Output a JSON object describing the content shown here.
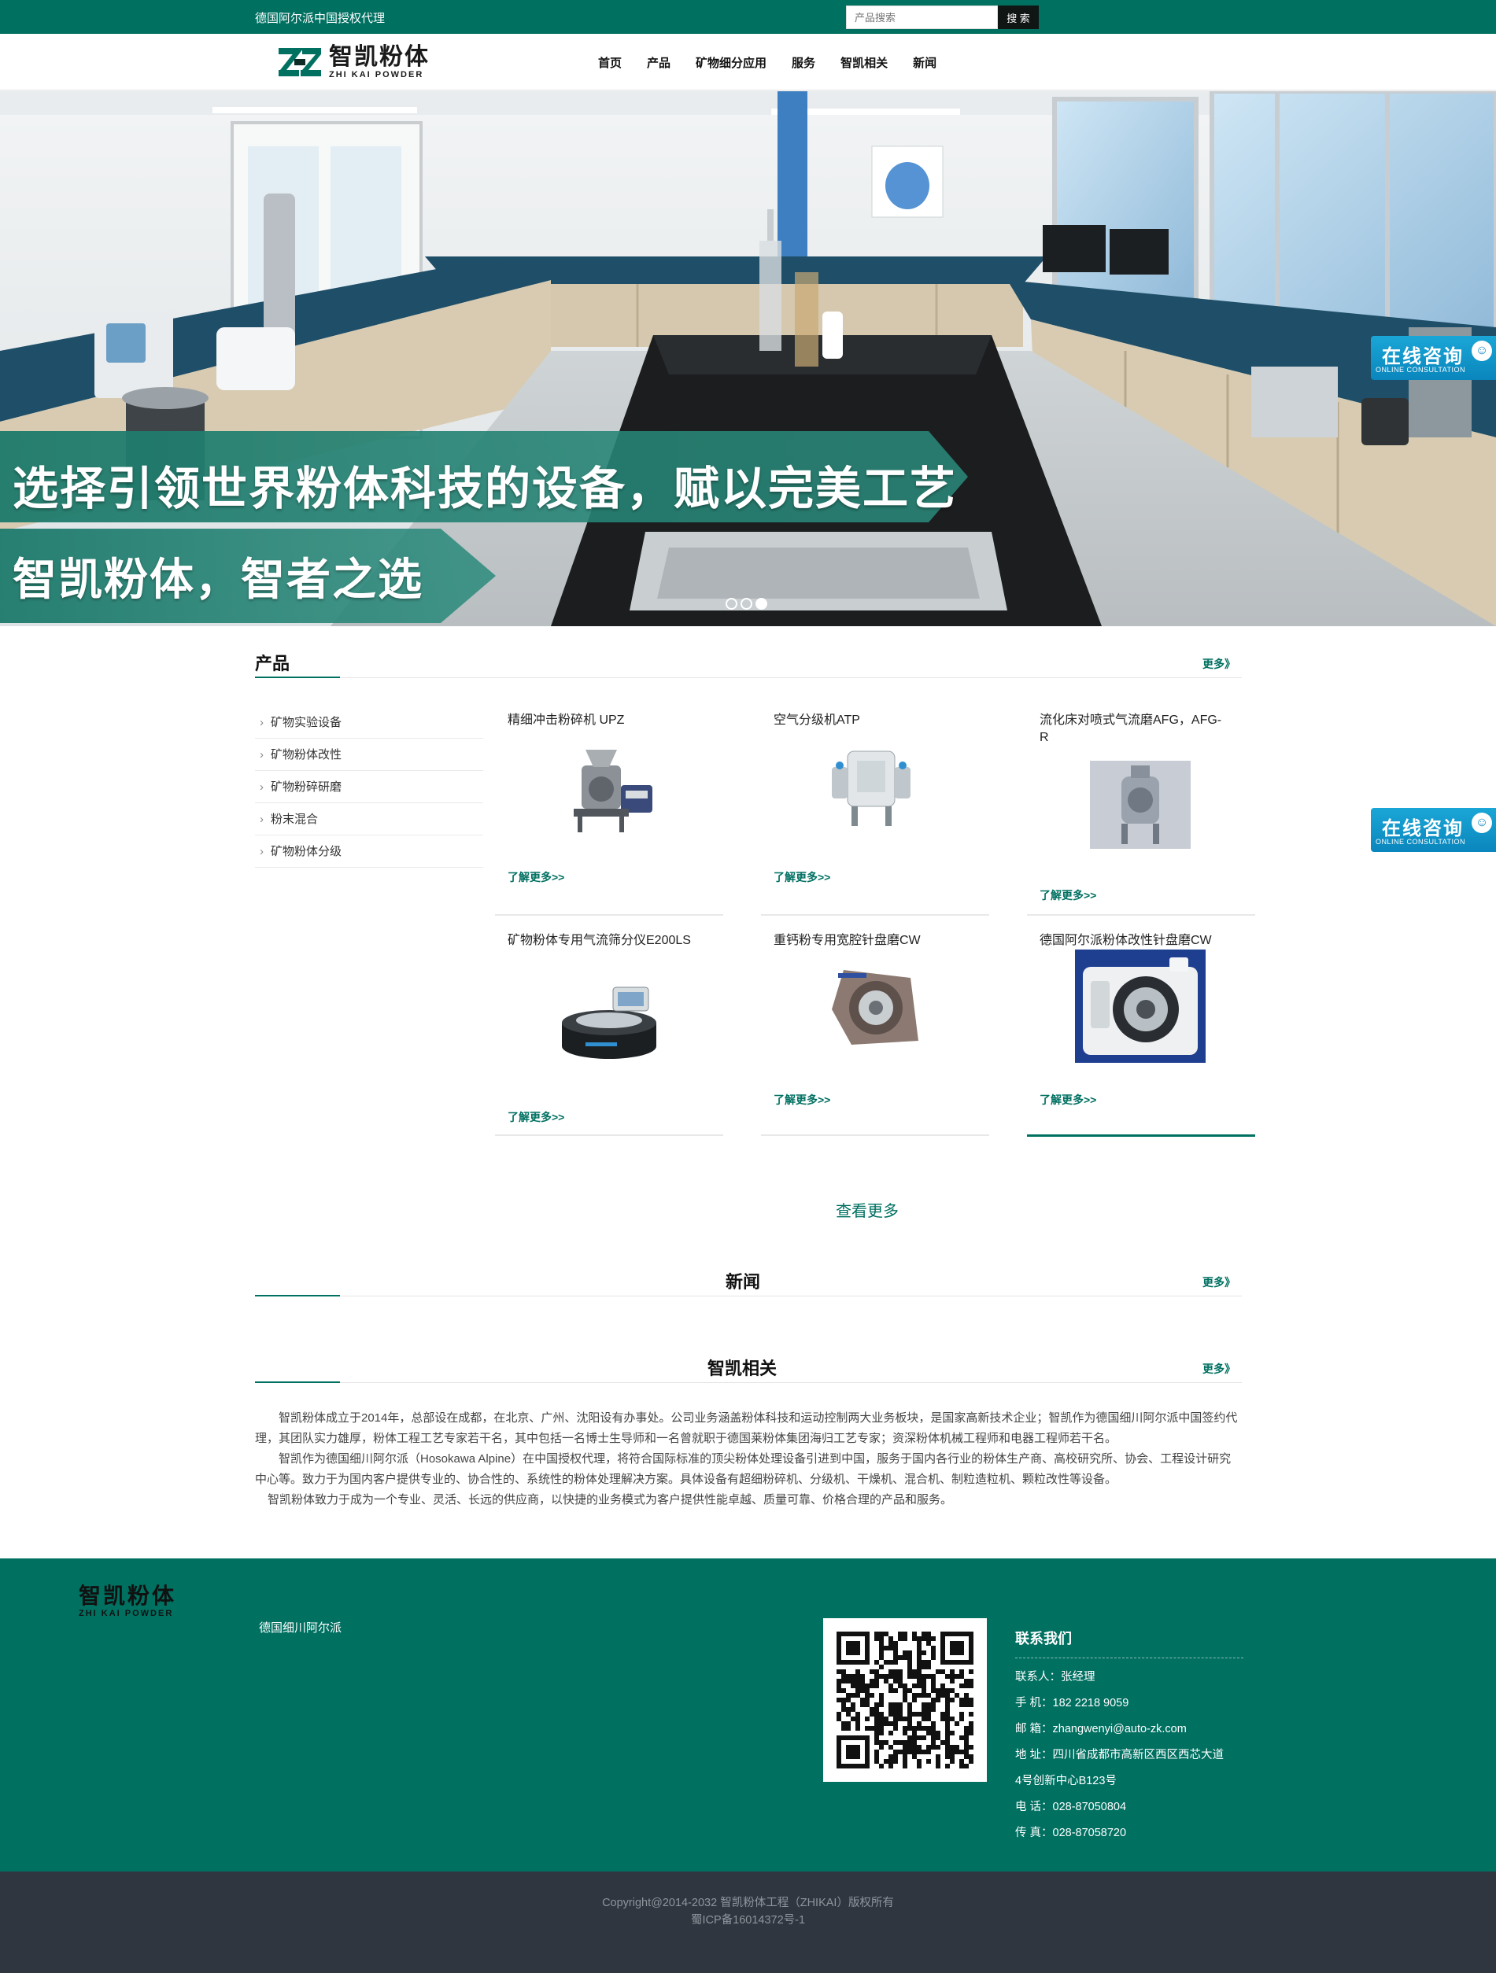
{
  "topbar": {
    "tagline": "德国阿尔派中国授权代理",
    "search_placeholder": "产品搜索",
    "search_button": "搜 索"
  },
  "logo": {
    "name_cn": "智凯粉体",
    "name_en": "ZHI KAI POWDER"
  },
  "nav": [
    "首页",
    "产品",
    "矿物细分应用",
    "服务",
    "智凯相关",
    "新闻"
  ],
  "banner": {
    "slogan_1": "选择引领世界粉体科技的设备，赋以完美工艺",
    "slogan_2": "智凯粉体，智者之选",
    "slide_count": 3,
    "active_slide": 3
  },
  "consult": {
    "label_cn": "在线咨询",
    "label_en": "ONLINE CONSULTATION"
  },
  "products": {
    "title": "产品",
    "more": "更多》",
    "categories": [
      "矿物实验设备",
      "矿物粉体改性",
      "矿物粉碎研磨",
      "粉末混合",
      "矿物粉体分级"
    ],
    "items": [
      {
        "name": "精细冲击粉碎机 UPZ",
        "link": "了解更多>>"
      },
      {
        "name": "空气分级机ATP",
        "link": "了解更多>>"
      },
      {
        "name": "流化床对喷式气流磨AFG，AFG-R",
        "link": "了解更多>>"
      },
      {
        "name": "矿物粉体专用气流筛分仪E200LS",
        "link": "了解更多>>"
      },
      {
        "name": "重钙粉专用宽腔针盘磨CW",
        "link": "了解更多>>"
      },
      {
        "name": "德国阿尔派粉体改性针盘磨CW",
        "link": "了解更多>>"
      }
    ],
    "view_more": "查看更多"
  },
  "news": {
    "title": "新闻",
    "more": "更多》"
  },
  "about": {
    "title": "智凯相关",
    "more": "更多》",
    "paragraphs": [
      "智凯粉体成立于2014年，总部设在成都，在北京、广州、沈阳设有办事处。公司业务涵盖粉体科技和运动控制两大业务板块，是国家高新技术企业；智凯作为德国细川阿尔派中国签约代理，其团队实力雄厚，粉体工程工艺专家若干名，其中包括一名博士生导师和一名曾就职于德国莱粉体集团海归工艺专家；资深粉体机械工程师和电器工程师若干名。",
      "智凯作为德国细川阿尔派（Hosokawa Alpine）在中国授权代理，将符合国际标准的顶尖粉体处理设备引进到中国，服务于国内各行业的粉体生产商、高校研究所、协会、工程设计研究中心等。致力于为国内客户提供专业的、协合性的、系统性的粉体处理解决方案。具体设备有超细粉碎机、分级机、干燥机、混合机、制粒造粒机、颗粒改性等设备。",
      "智凯粉体致力于成为一个专业、灵活、长远的供应商，以快捷的业务模式为客户提供性能卓越、质量可靠、价格合理的产品和服务。"
    ]
  },
  "footer": {
    "logo_cn": "智凯粉体",
    "logo_en": "ZHI KAI POWDER",
    "link": "德国细川阿尔派",
    "contact_title": "联系我们",
    "contact_lines": [
      "联系人：张经理",
      "手 机：182 2218 9059",
      "邮 箱：zhangwenyi@auto-zk.com",
      "地 址：四川省成都市高新区西区西芯大道",
      "4号创新中心B123号",
      "电 话：028-87050804",
      "传 真：028-87058720"
    ],
    "copyright_1": "Copyright@2014-2032 智凯粉体工程（ZHIKAI）版权所有",
    "copyright_2": "蜀ICP备16014372号-1"
  },
  "colors": {
    "brand": "#007061",
    "dark_footer": "#303640",
    "consult_blue": "#0a86bd"
  },
  "icons": [
    "logo-mark-icon",
    "chevron-right-icon",
    "chat-icon",
    "qr-code-icon"
  ]
}
